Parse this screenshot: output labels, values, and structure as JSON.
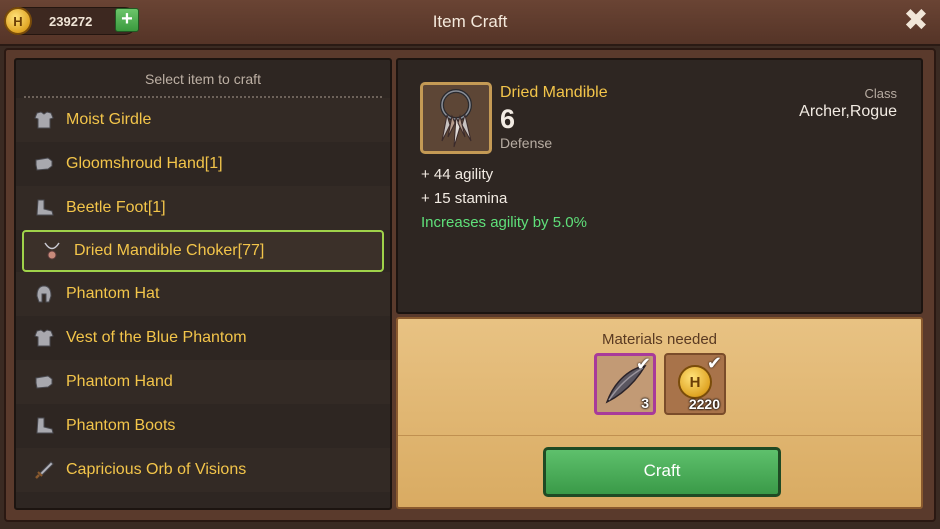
{
  "header": {
    "title": "Item Craft",
    "currency": {
      "symbol": "H",
      "amount": "239272",
      "add_label": "+"
    },
    "close_label": "✖"
  },
  "list": {
    "header": "Select item to craft",
    "items": [
      {
        "label": "Moist Girdle",
        "icon": "armor-icon",
        "selected": false
      },
      {
        "label": "Gloomshroud Hand[1]",
        "icon": "glove-icon",
        "selected": false
      },
      {
        "label": "Beetle Foot[1]",
        "icon": "boot-icon",
        "selected": false
      },
      {
        "label": "Dried Mandible Choker[77]",
        "icon": "necklace-icon",
        "selected": true
      },
      {
        "label": "Phantom Hat",
        "icon": "helmet-icon",
        "selected": false
      },
      {
        "label": "Vest of the Blue Phantom",
        "icon": "armor-icon",
        "selected": false
      },
      {
        "label": "Phantom Hand",
        "icon": "glove-icon",
        "selected": false
      },
      {
        "label": "Phantom Boots",
        "icon": "boot-icon",
        "selected": false
      },
      {
        "label": "Capricious Orb of Visions",
        "icon": "sword-icon",
        "selected": false
      }
    ]
  },
  "detail": {
    "name": "Dried Mandible",
    "value": "6",
    "stat_type": "Defense",
    "class_label": "Class",
    "class_value": "Archer,Rogue",
    "stats": [
      "+ 44 agility",
      "+ 15 stamina"
    ],
    "bonus": "Increases agility by 5.0%"
  },
  "materials": {
    "title": "Materials needed",
    "items": [
      {
        "icon": "feather-icon",
        "count": "3"
      },
      {
        "icon": "gold-coin-icon",
        "symbol": "H",
        "count": "2220"
      }
    ]
  },
  "craft_label": "Craft",
  "colors": {
    "accent": "#f3c54a",
    "bonus": "#5fe07a",
    "selected_border": "#9fd24a"
  }
}
